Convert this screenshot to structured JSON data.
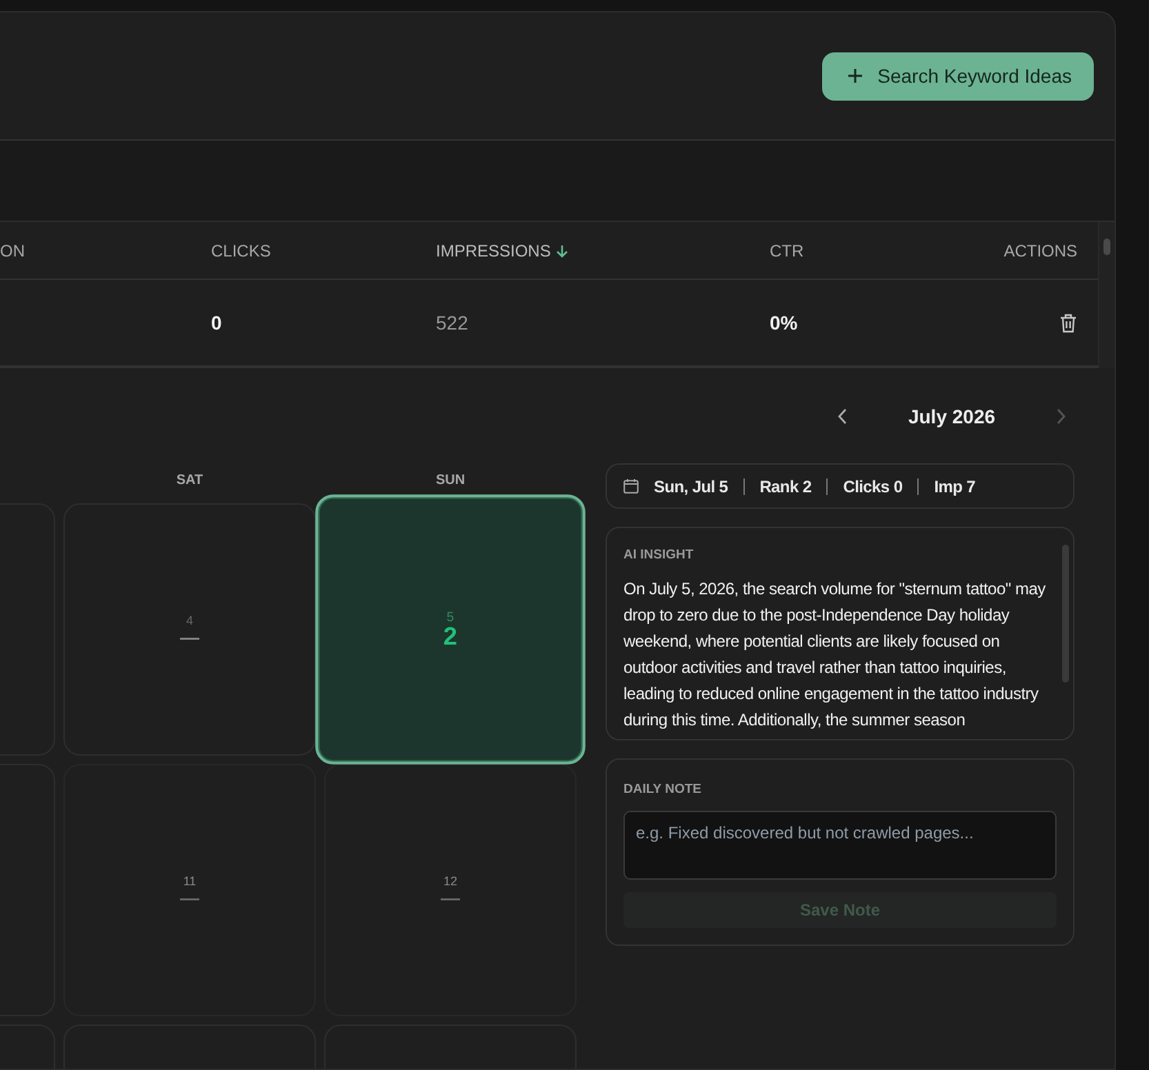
{
  "header": {
    "action_button": "Search Keyword Ideas"
  },
  "table": {
    "columns": [
      {
        "label": "ON",
        "sorted": false
      },
      {
        "label": "CLICKS",
        "sorted": false
      },
      {
        "label": "IMPRESSIONS",
        "sorted": true
      },
      {
        "label": "CTR",
        "sorted": false
      },
      {
        "label": "ACTIONS",
        "sorted": false
      }
    ],
    "rows": [
      {
        "column_1": "",
        "clicks": "0",
        "impressions": "522",
        "ctr": "0%"
      }
    ]
  },
  "calendar": {
    "month": "July 2026",
    "weekdays": [
      "SAT",
      "SUN"
    ],
    "weeks": [
      {
        "cells": [
          {
            "kind": "blank"
          },
          {
            "kind": "day",
            "day": "4",
            "value": "—",
            "selected": false,
            "dimmed": false
          },
          {
            "kind": "day",
            "day": "5",
            "value": "2",
            "selected": true,
            "dimmed": false
          }
        ]
      },
      {
        "cells": [
          {
            "kind": "blank"
          },
          {
            "kind": "day",
            "day": "11",
            "value": "—",
            "selected": false,
            "dimmed": true
          },
          {
            "kind": "day",
            "day": "12",
            "value": "—",
            "selected": false,
            "dimmed": true
          }
        ]
      },
      {
        "cells": [
          {
            "kind": "blank"
          },
          {
            "kind": "blank"
          },
          {
            "kind": "blank"
          }
        ]
      }
    ]
  },
  "day_summary": {
    "items": [
      "Sun, Jul 5",
      "Rank 2",
      "Clicks 0",
      "Imp 7"
    ]
  },
  "ai_insight": {
    "label": "AI INSIGHT",
    "text": "On July 5, 2026, the search volume for \"sternum tattoo\" may drop to zero due to the post-Independence Day holiday weekend, where potential clients are likely focused on outdoor activities and travel rather than tattoo inquiries, leading to reduced online engagement in the tattoo industry during this time. Additionally, the summer season"
  },
  "daily_note": {
    "label": "DAILY NOTE",
    "placeholder": "e.g. Fixed discovered but not crawled pages...",
    "button": "Save Note",
    "button_disabled": true
  }
}
